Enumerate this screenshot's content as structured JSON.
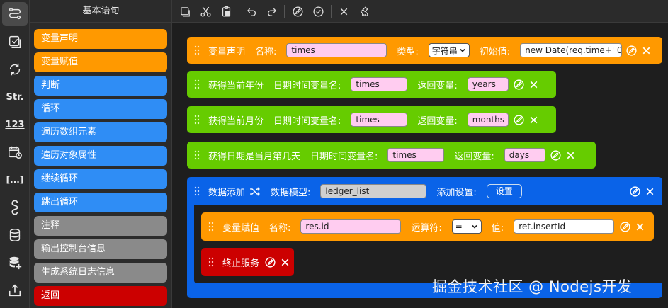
{
  "rail": {
    "items": [
      {
        "icon": "flow-icon",
        "active": true
      },
      {
        "icon": "checklist-icon"
      },
      {
        "icon": "transform-icon"
      },
      {
        "icon": "string-icon",
        "text": "Str."
      },
      {
        "icon": "number-icon",
        "text": "123"
      },
      {
        "icon": "datetime-icon"
      },
      {
        "icon": "array-icon",
        "text": "[...]"
      },
      {
        "icon": "regex-icon"
      },
      {
        "icon": "database-icon"
      },
      {
        "icon": "database-add-icon"
      },
      {
        "icon": "export-icon"
      }
    ]
  },
  "palette": {
    "title": "基本语句",
    "items": [
      {
        "label": "变量声明",
        "color": "#ff9900"
      },
      {
        "label": "变量赋值",
        "color": "#ff9900"
      },
      {
        "label": "判断",
        "color": "#2f8df5"
      },
      {
        "label": "循环",
        "color": "#2f8df5"
      },
      {
        "label": "遍历数组元素",
        "color": "#2f8df5"
      },
      {
        "label": "遍历对象属性",
        "color": "#2f8df5"
      },
      {
        "label": "继续循环",
        "color": "#2f8df5"
      },
      {
        "label": "跳出循环",
        "color": "#2f8df5"
      },
      {
        "label": "注释",
        "color": "#8a8a8a"
      },
      {
        "label": "输出控制台信息",
        "color": "#8a8a8a"
      },
      {
        "label": "生成系统日志信息",
        "color": "#8a8a8a"
      },
      {
        "label": "返回",
        "color": "#cc0000"
      }
    ]
  },
  "toolbar": {
    "buttons": [
      "copy-icon",
      "cut-icon",
      "paste-icon",
      "undo-icon",
      "redo-icon",
      "edit-circle-icon",
      "check-circle-icon",
      "close-icon",
      "clear-icon"
    ]
  },
  "blocks": {
    "var_decl": {
      "title": "变量声明",
      "name_label": "名称:",
      "name_value": "times",
      "type_label": "类型:",
      "type_value": "字符串",
      "init_label": "初始值:",
      "init_value": "new Date(req.time+' 0:"
    },
    "year": {
      "title": "获得当前年份",
      "var_label": "日期时间变量名:",
      "var_value": "times",
      "ret_label": "返回变量:",
      "ret_value": "years"
    },
    "month": {
      "title": "获得当前月份",
      "var_label": "日期时间变量名:",
      "var_value": "times",
      "ret_label": "返回变量:",
      "ret_value": "months"
    },
    "day": {
      "title": "获得日期是当月第几天",
      "var_label": "日期时间变量名:",
      "var_value": "times",
      "ret_label": "返回变量:",
      "ret_value": "days"
    },
    "data_add": {
      "title": "数据添加",
      "model_label": "数据模型:",
      "model_value": "ledger_list",
      "settings_label": "添加设置:",
      "settings_button": "设置"
    },
    "assign": {
      "title": "变量赋值",
      "name_label": "名称:",
      "name_value": "res.id",
      "op_label": "运算符:",
      "op_value": "=",
      "value_label": "值:",
      "value_value": "ret.insertId"
    },
    "stop": {
      "title": "终止服务"
    }
  },
  "watermark": "掘金技术社区 @ Nodejs开发"
}
